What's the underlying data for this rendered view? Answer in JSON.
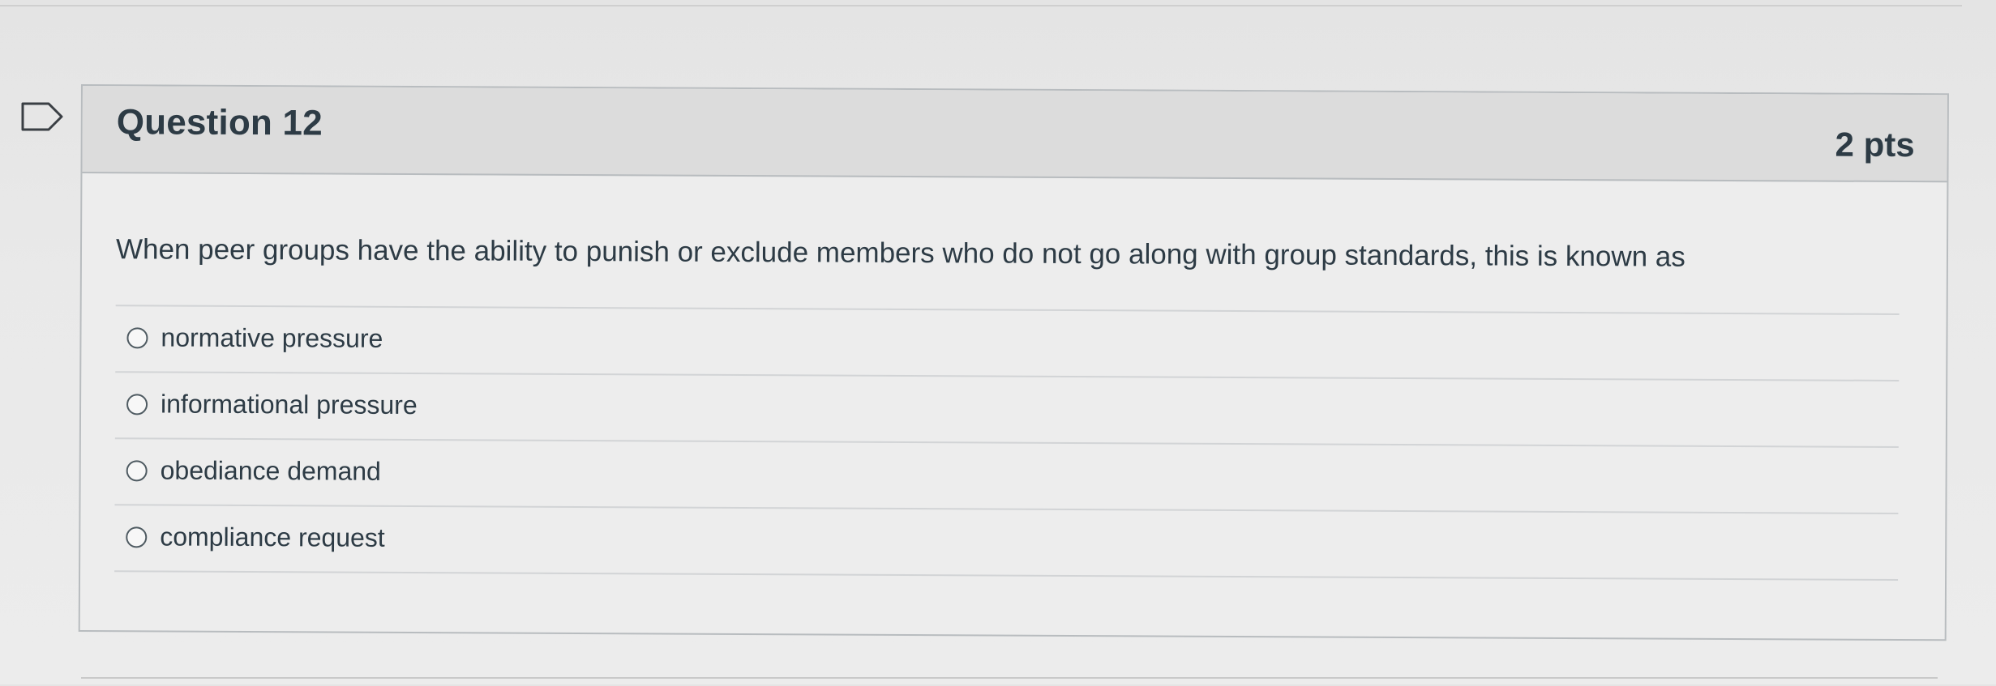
{
  "question": {
    "title": "Question 12",
    "points": "2 pts",
    "text": "When peer groups have the ability to punish or exclude members who do not go along with group standards, this is known as",
    "flag_icon": "flag-icon",
    "answers": [
      {
        "label": "normative pressure",
        "selected": false,
        "icon": "radio-unselected-icon"
      },
      {
        "label": "informational pressure",
        "selected": false,
        "icon": "radio-unselected-icon"
      },
      {
        "label": "obediance demand",
        "selected": false,
        "icon": "radio-unselected-icon"
      },
      {
        "label": "compliance request",
        "selected": false,
        "icon": "radio-unselected-icon"
      }
    ]
  },
  "colors": {
    "text": "#2d3b45",
    "header_bg": "#dcdcdc",
    "card_bg": "#ededed",
    "border": "#b8bcbf"
  }
}
